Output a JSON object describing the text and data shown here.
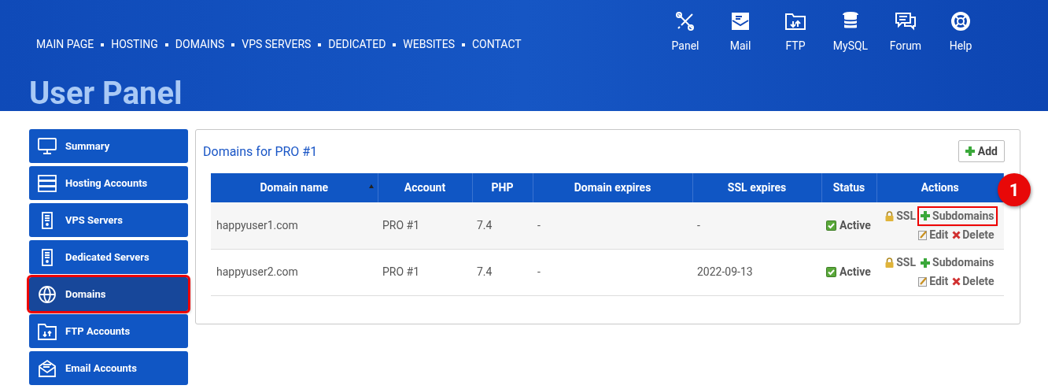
{
  "nav": [
    "MAIN PAGE",
    "HOSTING",
    "DOMAINS",
    "VPS SERVERS",
    "DEDICATED",
    "WEBSITES",
    "CONTACT"
  ],
  "tools": [
    {
      "kind": "tools",
      "label": "Panel"
    },
    {
      "kind": "mail",
      "label": "Mail"
    },
    {
      "kind": "ftp",
      "label": "FTP"
    },
    {
      "kind": "database",
      "label": "MySQL"
    },
    {
      "kind": "forum",
      "label": "Forum"
    },
    {
      "kind": "help",
      "label": "Help"
    }
  ],
  "title": "User Panel",
  "sidebar": {
    "items": [
      {
        "kind": "monitor",
        "label": "Summary",
        "selected": false,
        "highlighted": false
      },
      {
        "kind": "rack",
        "label": "Hosting Accounts",
        "selected": false,
        "highlighted": false
      },
      {
        "kind": "server",
        "label": "VPS Servers",
        "selected": false,
        "highlighted": false
      },
      {
        "kind": "server",
        "label": "Dedicated Servers",
        "selected": false,
        "highlighted": false
      },
      {
        "kind": "globe",
        "label": "Domains",
        "selected": true,
        "highlighted": true
      },
      {
        "kind": "ftp",
        "label": "FTP Accounts",
        "selected": false,
        "highlighted": false
      },
      {
        "kind": "mail",
        "label": "Email Accounts",
        "selected": false,
        "highlighted": false
      }
    ]
  },
  "panel": {
    "title": "Domains for PRO #1",
    "add_button": "Add",
    "table": {
      "columns": [
        {
          "label": "Domain name",
          "sorted": true
        },
        {
          "label": "Account",
          "sorted": false
        },
        {
          "label": "PHP",
          "sorted": false
        },
        {
          "label": "Domain expires",
          "sorted": false
        },
        {
          "label": "SSL expires",
          "sorted": false
        },
        {
          "label": "Status",
          "sorted": false
        },
        {
          "label": "Actions",
          "sorted": false
        }
      ],
      "rows": [
        {
          "domain": "happyuser1.com",
          "account": "PRO #1",
          "php": "7.4",
          "domain_expires": "-",
          "ssl_expires": "-",
          "status": "Active",
          "actions": {
            "ssl": "SSL",
            "subdomains": "Subdomains",
            "edit": "Edit",
            "delete": "Delete",
            "subdomains_highlighted": true
          }
        },
        {
          "domain": "happyuser2.com",
          "account": "PRO #1",
          "php": "7.4",
          "domain_expires": "-",
          "ssl_expires": "2022-09-13",
          "status": "Active",
          "actions": {
            "ssl": "SSL",
            "subdomains": "Subdomains",
            "edit": "Edit",
            "delete": "Delete",
            "subdomains_highlighted": false
          }
        }
      ]
    }
  },
  "callout": "1"
}
